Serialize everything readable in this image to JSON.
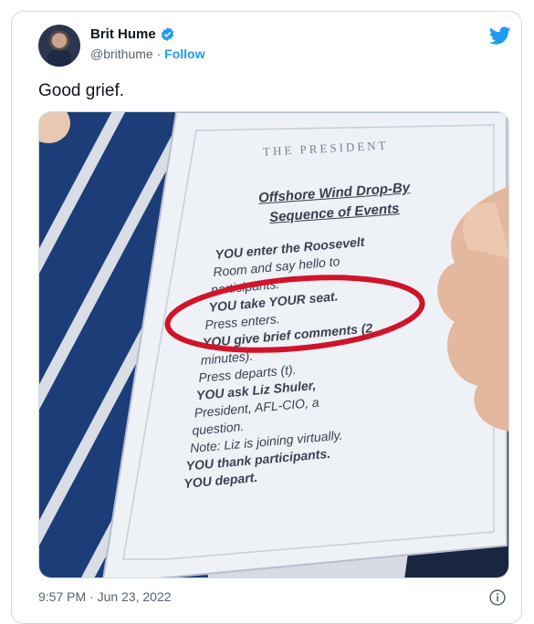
{
  "user": {
    "name": "Brit Hume",
    "handle": "@brithume",
    "follow_label": "Follow"
  },
  "tweet": {
    "text": "Good grief.",
    "timestamp": "9:57 PM · Jun 23, 2022"
  },
  "photo": {
    "header": "THE PRESIDENT",
    "title_line1": "Offshore Wind Drop-By",
    "title_line2": "Sequence of Events",
    "lines": [
      "YOU enter the Roosevelt",
      "Room and say hello to",
      "participants.",
      "YOU take YOUR seat.",
      "Press enters.",
      "YOU give brief comments (2",
      "minutes).",
      "Press departs (t).",
      "YOU ask Liz Shuler,",
      "President, AFL-CIO, a",
      "question.",
      "Note: Liz is joining virtually.",
      "YOU thank participants.",
      "YOU depart."
    ]
  },
  "colors": {
    "accent": "#1d9bf0",
    "circle": "#d0142a",
    "tie": "#1c3d78",
    "card": "#eef1f6"
  }
}
